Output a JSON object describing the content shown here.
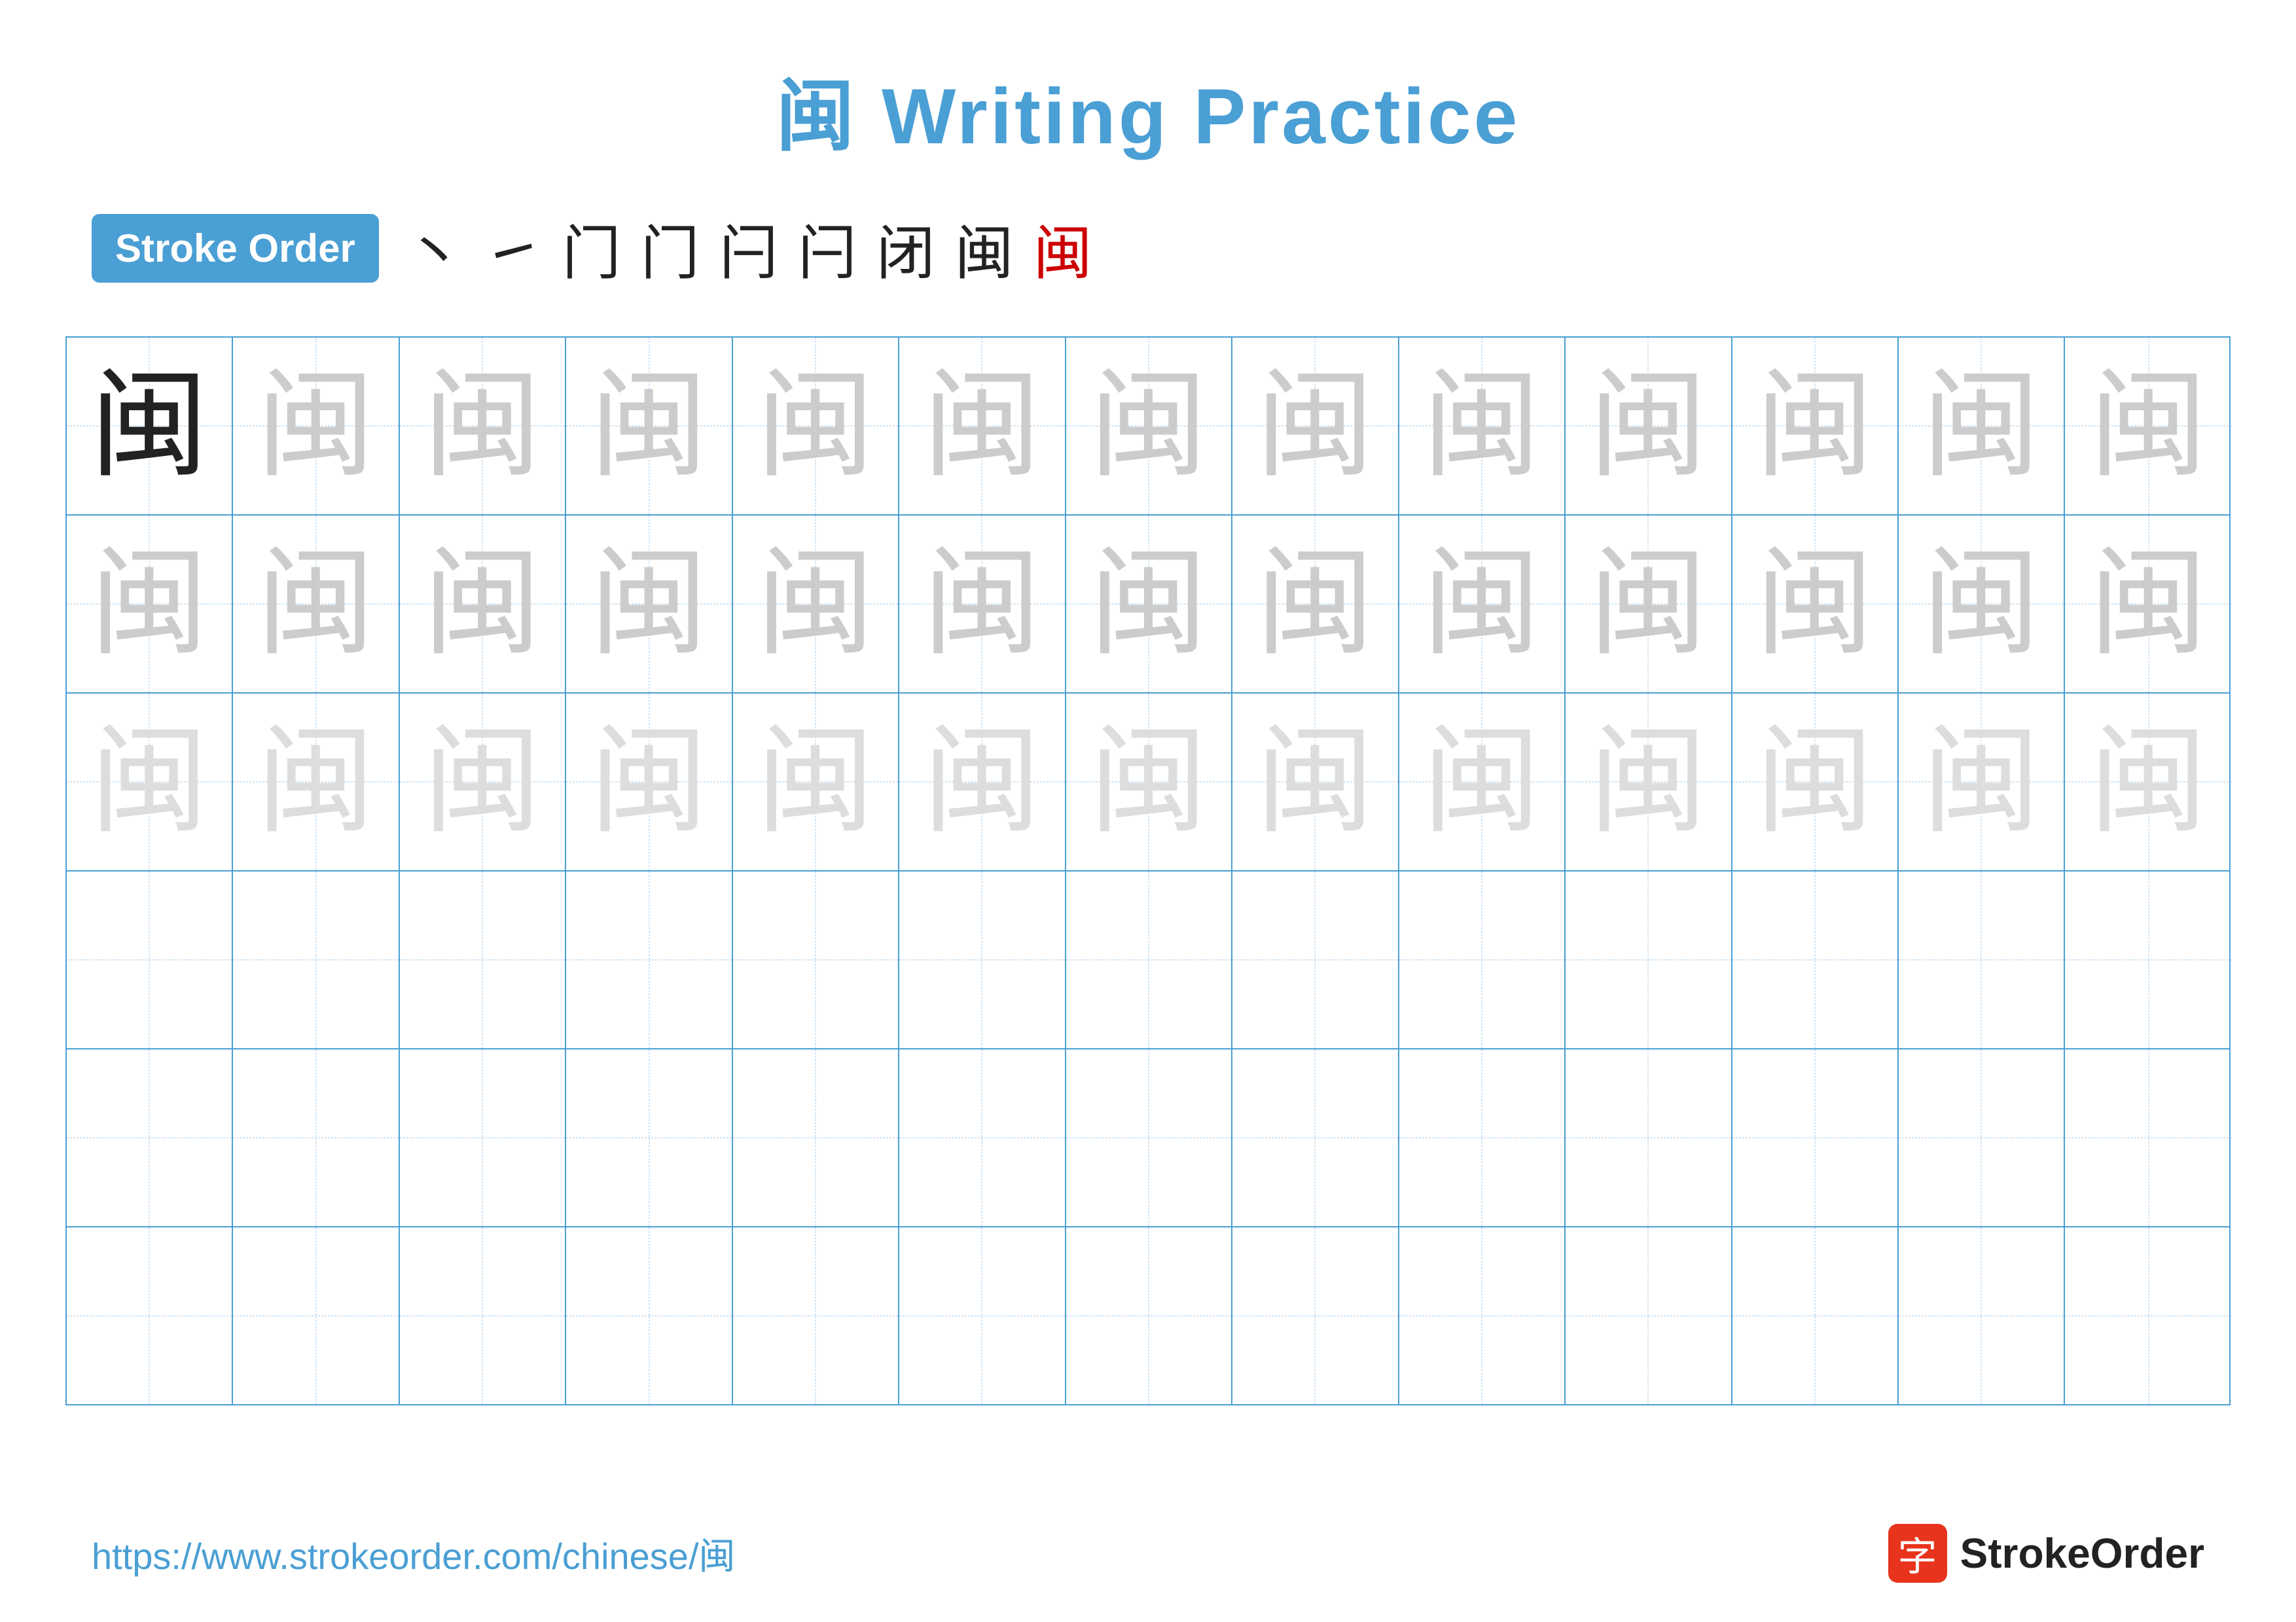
{
  "title": "闽 Writing Practice",
  "stroke_order": {
    "badge_label": "Stroke Order",
    "strokes": [
      "丶",
      "㇀",
      "门",
      "门",
      "闩",
      "闩",
      "闭",
      "闽",
      "闽"
    ]
  },
  "character": "闽",
  "rows": [
    {
      "type": "dark_then_light",
      "dark_count": 1,
      "light_count": 12
    },
    {
      "type": "all_light",
      "count": 13
    },
    {
      "type": "all_lighter",
      "count": 13
    },
    {
      "type": "empty",
      "count": 13
    },
    {
      "type": "empty",
      "count": 13
    },
    {
      "type": "empty",
      "count": 13
    }
  ],
  "footer": {
    "url": "https://www.strokeorder.com/chinese/闽",
    "logo_icon": "字",
    "logo_text": "StrokeOrder"
  }
}
